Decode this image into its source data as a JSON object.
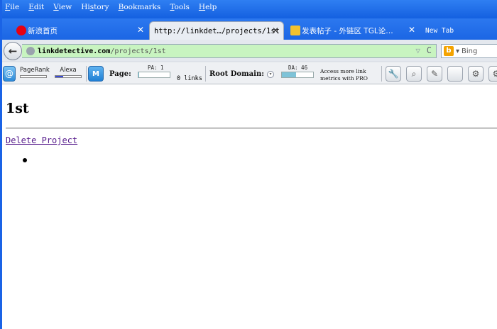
{
  "menubar": {
    "items": [
      {
        "u": "F",
        "rest": "ile"
      },
      {
        "u": "E",
        "rest": "dit"
      },
      {
        "u": "V",
        "rest": "iew"
      },
      {
        "pre": "Hi",
        "u": "s",
        "rest": "tory"
      },
      {
        "u": "B",
        "rest": "ookmarks"
      },
      {
        "u": "T",
        "rest": "ools"
      },
      {
        "u": "H",
        "rest": "elp"
      }
    ]
  },
  "tabs": [
    {
      "label": "新浪首页",
      "close": "✕"
    },
    {
      "label": "http://linkdet…/projects/1st",
      "close": "✕"
    },
    {
      "label": "发表帖子 - 外链区 TGL论…",
      "close": "✕"
    },
    {
      "label": "New Tab"
    }
  ],
  "navbar": {
    "url_host": "linkdetective.com",
    "url_path": "/projects/1st",
    "search_placeholder": "Bing",
    "search_caret": "▾",
    "star": "▽",
    "reload": "C"
  },
  "toolbar": {
    "pagerank_label": "PageRank",
    "alexa_label": "Alexa",
    "moz_label": "M",
    "page_label": "Page:",
    "pa_label": "PA: 1",
    "pa_value": 1,
    "links_text": "0 links",
    "root_domain_label": "Root Domain:",
    "da_label": "DA: 46",
    "da_value": 46,
    "pro_line1": "Access more link",
    "pro_line2": "metrics with PRO"
  },
  "page": {
    "title": "1st",
    "delete_link": "Delete Project"
  }
}
